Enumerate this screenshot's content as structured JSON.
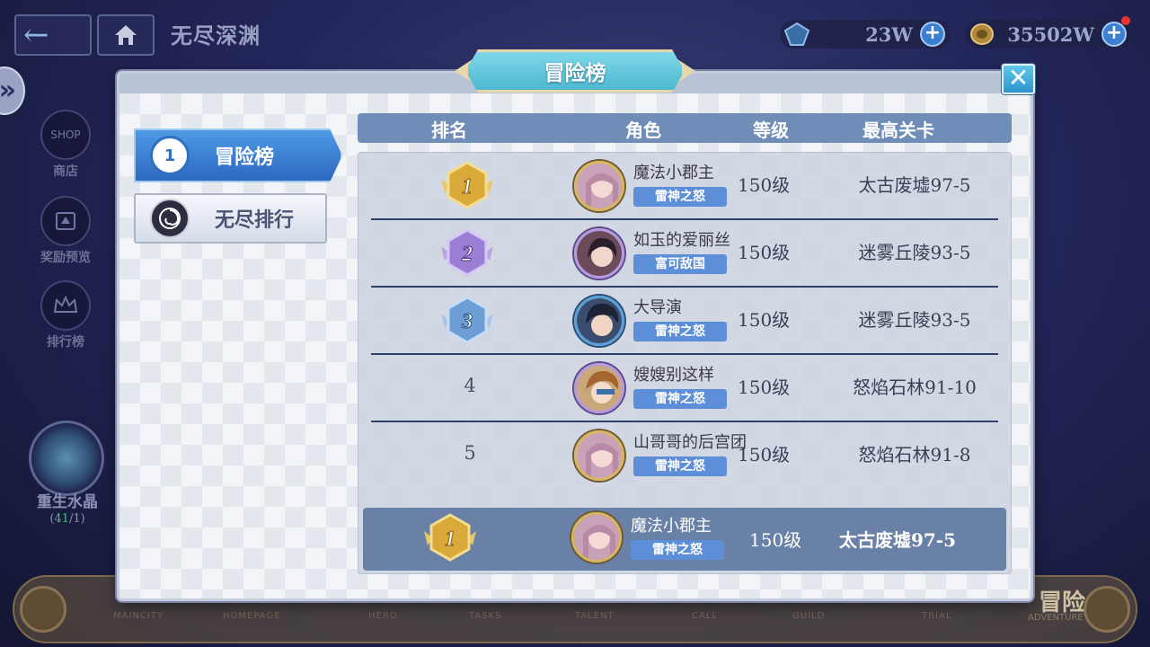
{
  "header": {
    "back_icon": "back-arrow-icon",
    "home_icon": "home-icon",
    "title": "无尽深渊",
    "gems": "23W",
    "coins": "35502W",
    "plus_symbol": "+"
  },
  "left_menu": [
    {
      "label": "商店",
      "icon": "shop-icon",
      "badge": "SHOP"
    },
    {
      "label": "奖励预览",
      "icon": "reward-preview-icon"
    },
    {
      "label": "排行榜",
      "icon": "crown-icon"
    }
  ],
  "crystal": {
    "label": "重生水晶",
    "count_open": "(",
    "count_current": "41",
    "count_rest": "/1)"
  },
  "bottom_bar": {
    "tabs": [
      "MAINCITY",
      "HOMEPAGE",
      "HERO",
      "TASKS",
      "TALENT",
      "CALL",
      "GUILD",
      "TRIAL"
    ],
    "active_label": "冒险",
    "active_en": "ADVENTURE"
  },
  "modal": {
    "title": "冒险榜",
    "close_symbol": "✕",
    "tabs": [
      {
        "label": "冒险榜",
        "icon": "rank-badge-icon",
        "icon_text": "1",
        "active": true
      },
      {
        "label": "无尽排行",
        "icon": "swirl-icon",
        "active": false
      }
    ],
    "columns": [
      "排名",
      "角色",
      "等级",
      "最高关卡"
    ],
    "rows": [
      {
        "rank": "1",
        "name": "魔法小郡主",
        "guild": "雷神之怒",
        "level": "150级",
        "stage": "太古废墟97-5",
        "medal": "gold"
      },
      {
        "rank": "2",
        "name": "如玉的爱丽丝",
        "guild": "富可敌国",
        "level": "150级",
        "stage": "迷雾丘陵93-5",
        "medal": "purple"
      },
      {
        "rank": "3",
        "name": "大导演",
        "guild": "雷神之怒",
        "level": "150级",
        "stage": "迷雾丘陵93-5",
        "medal": "blue"
      },
      {
        "rank": "4",
        "name": "嫂嫂别这样",
        "guild": "雷神之怒",
        "level": "150级",
        "stage": "怒焰石林91-10",
        "medal": "none"
      },
      {
        "rank": "5",
        "name": "山哥哥的后宫团",
        "guild": "雷神之怒",
        "level": "150级",
        "stage": "怒焰石林91-8",
        "medal": "none"
      }
    ],
    "self": {
      "rank": "1",
      "name": "魔法小郡主",
      "guild": "雷神之怒",
      "level": "150级",
      "stage": "太古废墟97-5",
      "medal": "gold"
    }
  },
  "colors": {
    "gold": "#d9a93a",
    "purple": "#9b7fd6",
    "blue": "#6d9ed6",
    "accent_blue": "#2d68c0",
    "header_row": "#6f8db6"
  }
}
